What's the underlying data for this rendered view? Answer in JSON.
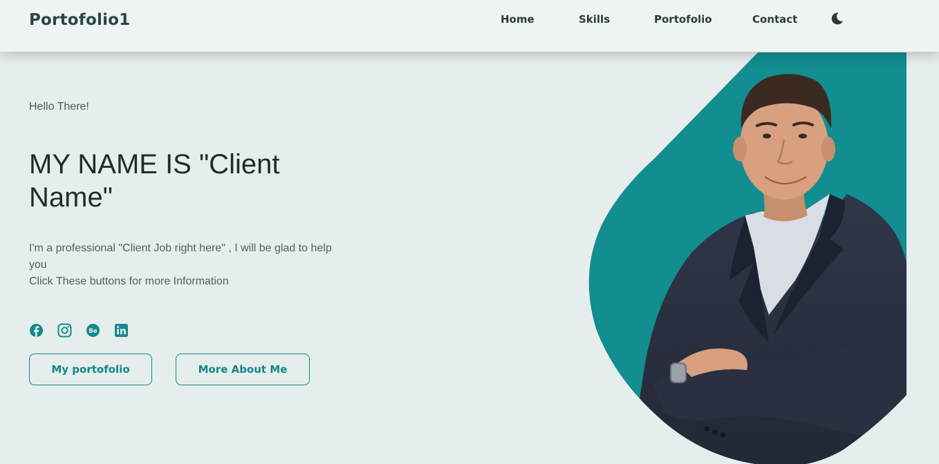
{
  "header": {
    "logo": "Portofolio1",
    "nav": [
      "Home",
      "Skills",
      "Portofolio",
      "Contact"
    ],
    "theme_icon": "moon-icon"
  },
  "hero": {
    "greeting": "Hello There!",
    "title": "MY NAME IS \"Client Name\"",
    "description_line1": "I'm a professional \"Client Job right here\" , I will be glad to help you",
    "description_line2": "Click These buttons for more Information",
    "socials": [
      "facebook-icon",
      "instagram-icon",
      "behance-icon",
      "linkedin-icon"
    ],
    "buttons": {
      "portfolio": "My portofolio",
      "about": "More About Me"
    }
  },
  "colors": {
    "accent": "#14888d",
    "background": "#e6eeed",
    "header_bg": "#edf4f3",
    "blob": "#128d90"
  }
}
